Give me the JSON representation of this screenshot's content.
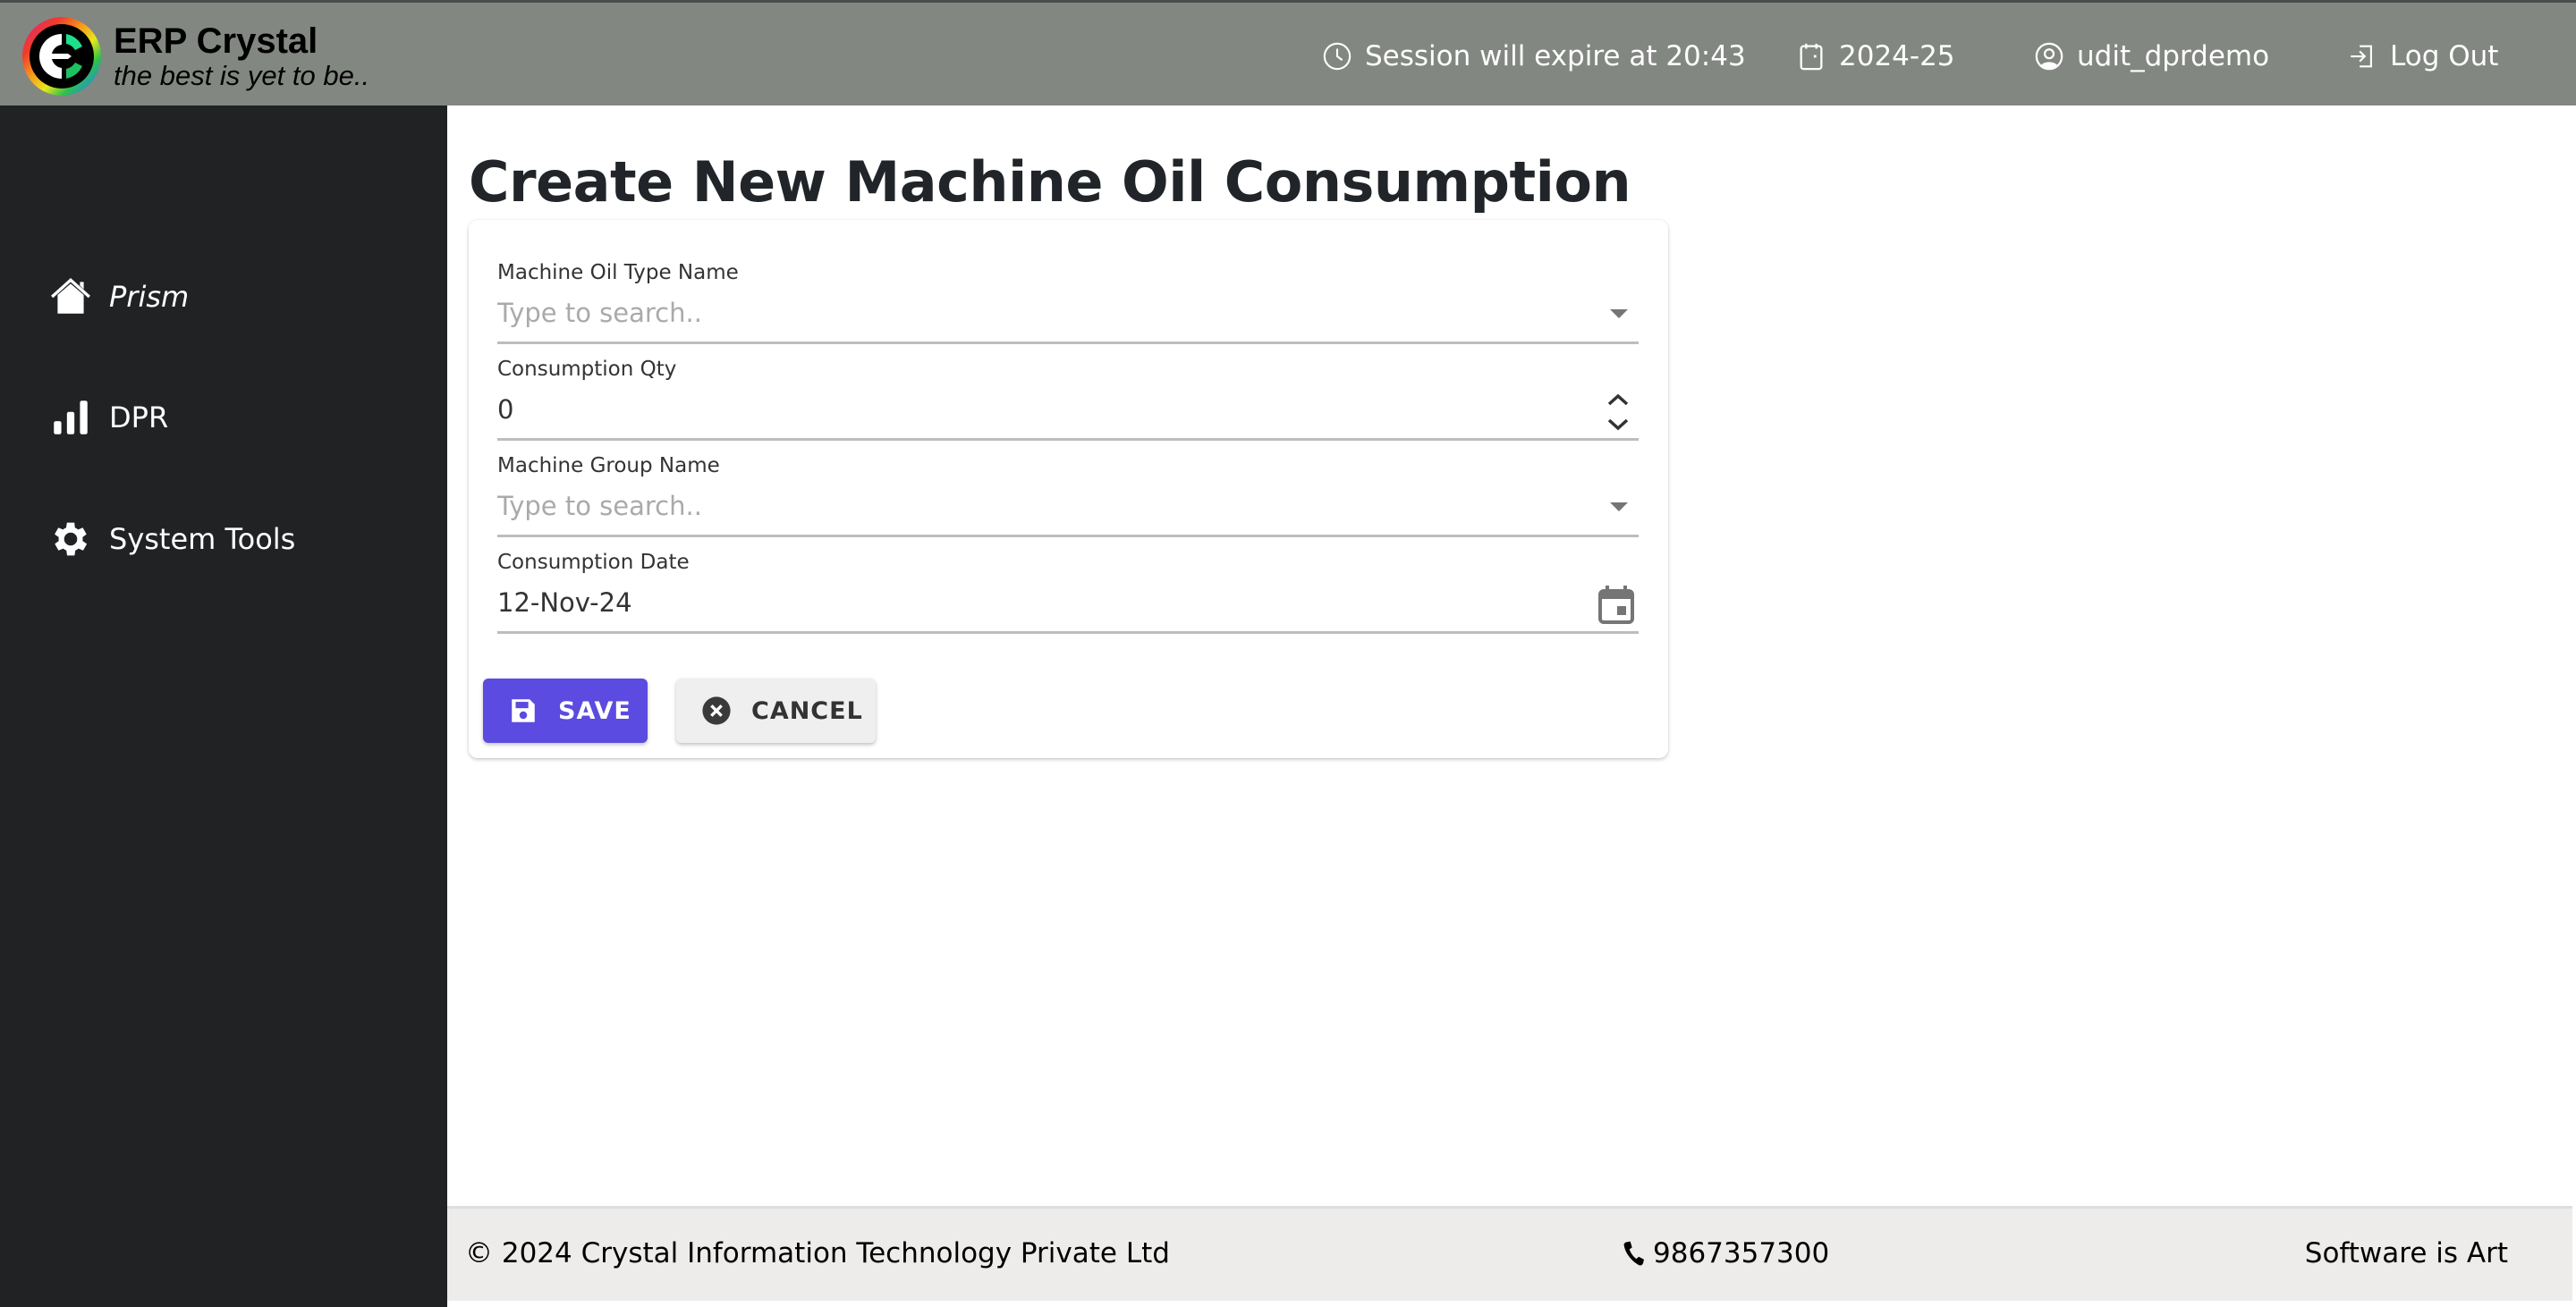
{
  "header": {
    "app_name": "ERP Crystal",
    "tagline": "the best is yet to be..",
    "session_text": "Session will expire at 20:43",
    "financial_year": "2024-25",
    "username": "udit_dprdemo",
    "logout_label": "Log Out",
    "background_color": "#838782"
  },
  "sidebar": {
    "items": [
      {
        "label": "Prism",
        "icon": "home-icon"
      },
      {
        "label": "DPR",
        "icon": "bar-chart-icon"
      },
      {
        "label": "System Tools",
        "icon": "gear-icon"
      }
    ],
    "background_color": "#212224"
  },
  "main": {
    "title": "Create New Machine Oil Consumption",
    "form": {
      "fields": [
        {
          "label": "Machine Oil Type Name",
          "value": "",
          "placeholder": "Type to search..",
          "type": "dropdown"
        },
        {
          "label": "Consumption Qty",
          "value": "0",
          "placeholder": "",
          "type": "number"
        },
        {
          "label": "Machine Group Name",
          "value": "",
          "placeholder": "Type to search..",
          "type": "dropdown"
        },
        {
          "label": "Consumption Date",
          "value": "12-Nov-24",
          "placeholder": "",
          "type": "date"
        }
      ],
      "save_label": "SAVE",
      "cancel_label": "CANCEL",
      "save_color": "#5B4BE0"
    }
  },
  "footer": {
    "copyright": "© 2024 Crystal Information Technology Private Ltd",
    "phone": "9867357300",
    "slogan": "Software is Art"
  }
}
